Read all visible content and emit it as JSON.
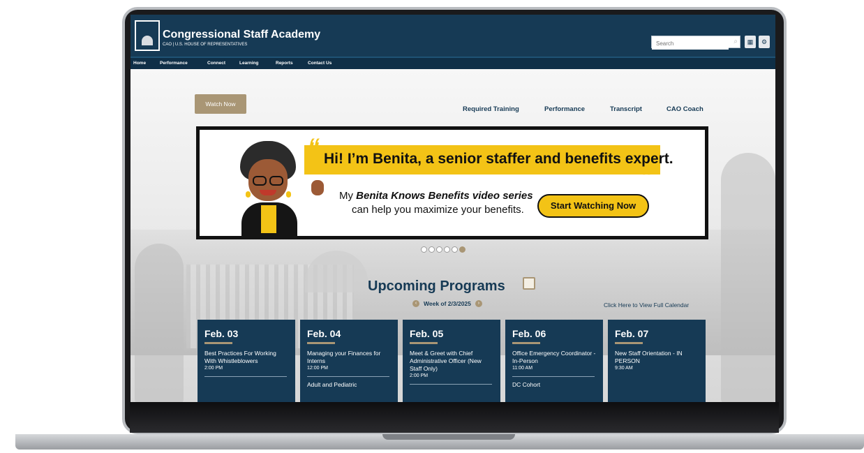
{
  "header": {
    "title": "Congressional Staff Academy",
    "subtitle": "CAO | U.S. HOUSE OF REPRESENTATIVES",
    "search_placeholder": "Search",
    "icons": [
      "search-icon",
      "grid-icon",
      "gear-icon"
    ]
  },
  "nav": {
    "items": [
      "Home",
      "Performance",
      "Connect",
      "Learning",
      "Reports",
      "Contact Us"
    ]
  },
  "hero": {
    "watch_now": "Watch Now",
    "quick_links": [
      "Required Training",
      "Performance",
      "Transcript",
      "CAO Coach"
    ]
  },
  "banner": {
    "headline": "Hi! I’m Benita, a senior staffer and benefits expert.",
    "line1_prefix": "My ",
    "line1_emphasis": "Benita Knows Benefits video series",
    "line2": "can help you maximize your benefits.",
    "cta": "Start Watching Now",
    "quote_open": "“",
    "quote_close": "”"
  },
  "carousel": {
    "dot_count": 6,
    "active_index": 5
  },
  "upcoming": {
    "title": "Upcoming Programs",
    "week": "Week of 2/3/2025",
    "full_calendar": "Click Here to View Full Calendar",
    "days": [
      {
        "date": "Feb. 03",
        "events": [
          {
            "title": "Best Practices For Working With Whistleblowers",
            "time": "2:00 PM"
          }
        ]
      },
      {
        "date": "Feb. 04",
        "events": [
          {
            "title": "Managing your Finances for Interns",
            "time": "12:00 PM"
          },
          {
            "title": "Adult and Pediatric",
            "time": ""
          }
        ]
      },
      {
        "date": "Feb. 05",
        "events": [
          {
            "title": "Meet & Greet with Chief Administrative Officer (New Staff Only)",
            "time": "2:00 PM"
          }
        ]
      },
      {
        "date": "Feb. 06",
        "events": [
          {
            "title": "Office Emergency Coordinator - In-Person",
            "time": "11:00 AM"
          },
          {
            "title": "DC Cohort",
            "time": ""
          }
        ]
      },
      {
        "date": "Feb. 07",
        "events": [
          {
            "title": "New Staff Orientation - IN PERSON",
            "time": "9:30 AM"
          }
        ]
      }
    ]
  },
  "colors": {
    "navy": "#163a55",
    "gold": "#a99675",
    "yellow": "#f3c316"
  }
}
